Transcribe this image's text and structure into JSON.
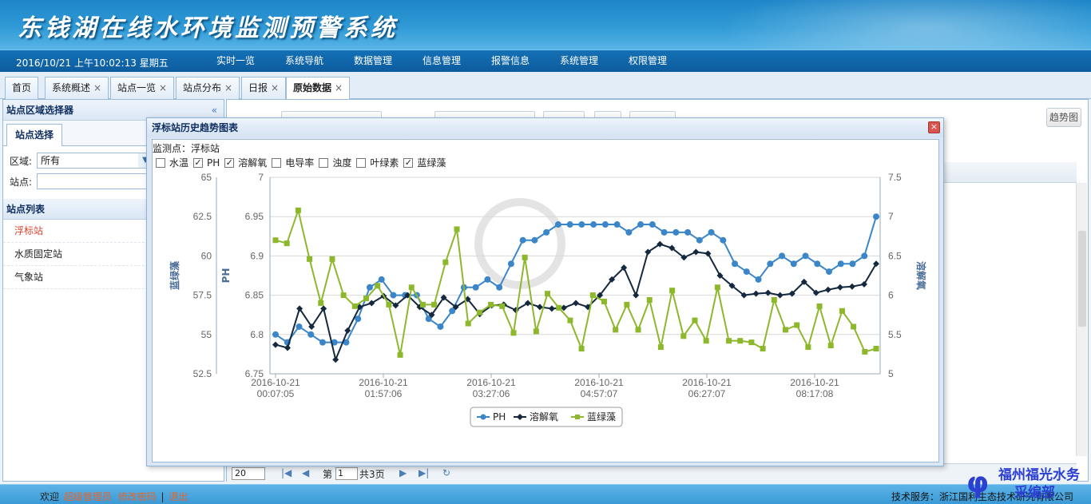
{
  "header": {
    "title": "东钱湖在线水环境监测预警系统",
    "datetime": "2016/10/21 上午10:02:13 星期五",
    "menu": [
      "实时一览",
      "系统导航",
      "数据管理",
      "信息管理",
      "报警信息",
      "系统管理",
      "权限管理"
    ]
  },
  "tabs": [
    {
      "label": "首页",
      "closable": false
    },
    {
      "label": "系统概述",
      "closable": true
    },
    {
      "label": "站点一览",
      "closable": true
    },
    {
      "label": "站点分布",
      "closable": true
    },
    {
      "label": "日报",
      "closable": true
    },
    {
      "label": "原始数据",
      "closable": true,
      "active": true
    }
  ],
  "sidebar": {
    "region_header": "站点区域选择器",
    "collapse_glyph": "«",
    "subtab": "站点选择",
    "region_label": "区域:",
    "region_value": "所有",
    "site_label": "站点:",
    "list_header": "站点列表",
    "sites": [
      "浮标站",
      "水质固定站",
      "气象站"
    ]
  },
  "main": {
    "trend_button": "趋势图",
    "pager": {
      "page_size": "20",
      "page_label": "第",
      "page_value": "1",
      "total": "共3页"
    }
  },
  "dialog": {
    "title": "浮标站历史趋势图表",
    "close_glyph": "×",
    "station": "监测点：浮标站",
    "checkboxes": [
      {
        "label": "水温",
        "checked": false
      },
      {
        "label": "PH",
        "checked": true
      },
      {
        "label": "溶解氧",
        "checked": true
      },
      {
        "label": "电导率",
        "checked": false
      },
      {
        "label": "浊度",
        "checked": false
      },
      {
        "label": "叶绿素",
        "checked": false
      },
      {
        "label": "蓝绿藻",
        "checked": true
      }
    ]
  },
  "chart_data": {
    "type": "line",
    "title": "",
    "x_tick_labels": [
      [
        "2016-10-21",
        "00:07:05"
      ],
      [
        "2016-10-21",
        "01:57:06"
      ],
      [
        "2016-10-21",
        "03:27:06"
      ],
      [
        "2016-10-21",
        "04:57:07"
      ],
      [
        "2016-10-21",
        "06:27:07"
      ],
      [
        "2016-10-21",
        "08:17:08"
      ]
    ],
    "axes": {
      "left_outer": {
        "label": "蓝绿藻",
        "ticks": [
          "52.5",
          "55",
          "57.5",
          "60",
          "62.5",
          "65"
        ],
        "range": [
          52.5,
          65
        ]
      },
      "left_inner": {
        "label": "PH",
        "ticks": [
          "6.75",
          "6.8",
          "6.85",
          "6.9",
          "6.95",
          "7"
        ],
        "range": [
          6.75,
          7
        ]
      },
      "right": {
        "label": "溶解氧",
        "ticks": [
          "5",
          "5.5",
          "6",
          "6.5",
          "7",
          "7.5"
        ],
        "range": [
          5,
          7.5
        ]
      }
    },
    "legend_position": "bottom-center",
    "grid": true,
    "series": [
      {
        "name": "PH",
        "color": "#3a86c8",
        "marker": "circle",
        "axis": "left_inner",
        "values": [
          6.8,
          6.79,
          6.81,
          6.8,
          6.79,
          6.79,
          6.79,
          6.82,
          6.86,
          6.87,
          6.85,
          6.85,
          6.85,
          6.82,
          6.81,
          6.83,
          6.86,
          6.86,
          6.87,
          6.86,
          6.89,
          6.92,
          6.92,
          6.93,
          6.94,
          6.94,
          6.94,
          6.94,
          6.94,
          6.94,
          6.93,
          6.94,
          6.94,
          6.93,
          6.93,
          6.93,
          6.92,
          6.93,
          6.92,
          6.89,
          6.88,
          6.87,
          6.89,
          6.9,
          6.89,
          6.9,
          6.89,
          6.88,
          6.89,
          6.89,
          6.9,
          6.95
        ]
      },
      {
        "name": "溶解氧",
        "color": "#14283e",
        "marker": "diamond",
        "axis": "right",
        "values": [
          5.37,
          5.33,
          5.83,
          5.6,
          5.83,
          5.18,
          5.55,
          5.85,
          5.9,
          5.99,
          5.87,
          6.0,
          5.85,
          5.75,
          5.97,
          5.85,
          5.95,
          5.76,
          5.87,
          5.88,
          5.81,
          5.9,
          5.85,
          5.83,
          5.84,
          5.9,
          5.85,
          6.0,
          6.2,
          6.35,
          6.0,
          6.55,
          6.65,
          6.6,
          6.48,
          6.55,
          6.53,
          6.25,
          6.12,
          6.0,
          6.02,
          6.03,
          6.0,
          6.02,
          6.17,
          6.03,
          6.07,
          6.1,
          6.11,
          6.14,
          6.4
        ]
      },
      {
        "name": "蓝绿藻",
        "color": "#8db82c",
        "marker": "square",
        "axis": "left_outer",
        "values": [
          61,
          60.8,
          62.9,
          59.8,
          57,
          59.8,
          57.5,
          56.8,
          57.3,
          58.1,
          56.9,
          53.7,
          58,
          56.9,
          56.9,
          59.6,
          61.7,
          55.7,
          56.4,
          56.9,
          56.8,
          55.1,
          59.9,
          55.2,
          57.6,
          56.7,
          55.9,
          54.1,
          57.5,
          57.1,
          55.3,
          56.9,
          55.3,
          57.2,
          54.2,
          57.8,
          54.9,
          55.9,
          54.6,
          58,
          54.6,
          54.6,
          54.5,
          54.1,
          57.2,
          55.3,
          55.6,
          54.2,
          56.8,
          54.3,
          56.5,
          55.5,
          53.9,
          54.1
        ]
      }
    ]
  },
  "footer": {
    "welcome": "欢迎",
    "user_link": "超级管理员",
    "change_pwd": "修改密码",
    "sep": "|",
    "logout": "退出",
    "tech_service": "技术服务：浙江国利生态技术研究有限公司"
  },
  "brand": {
    "logo_glyph": "φ",
    "line1": "福州福光水务",
    "line2": "采编部"
  }
}
